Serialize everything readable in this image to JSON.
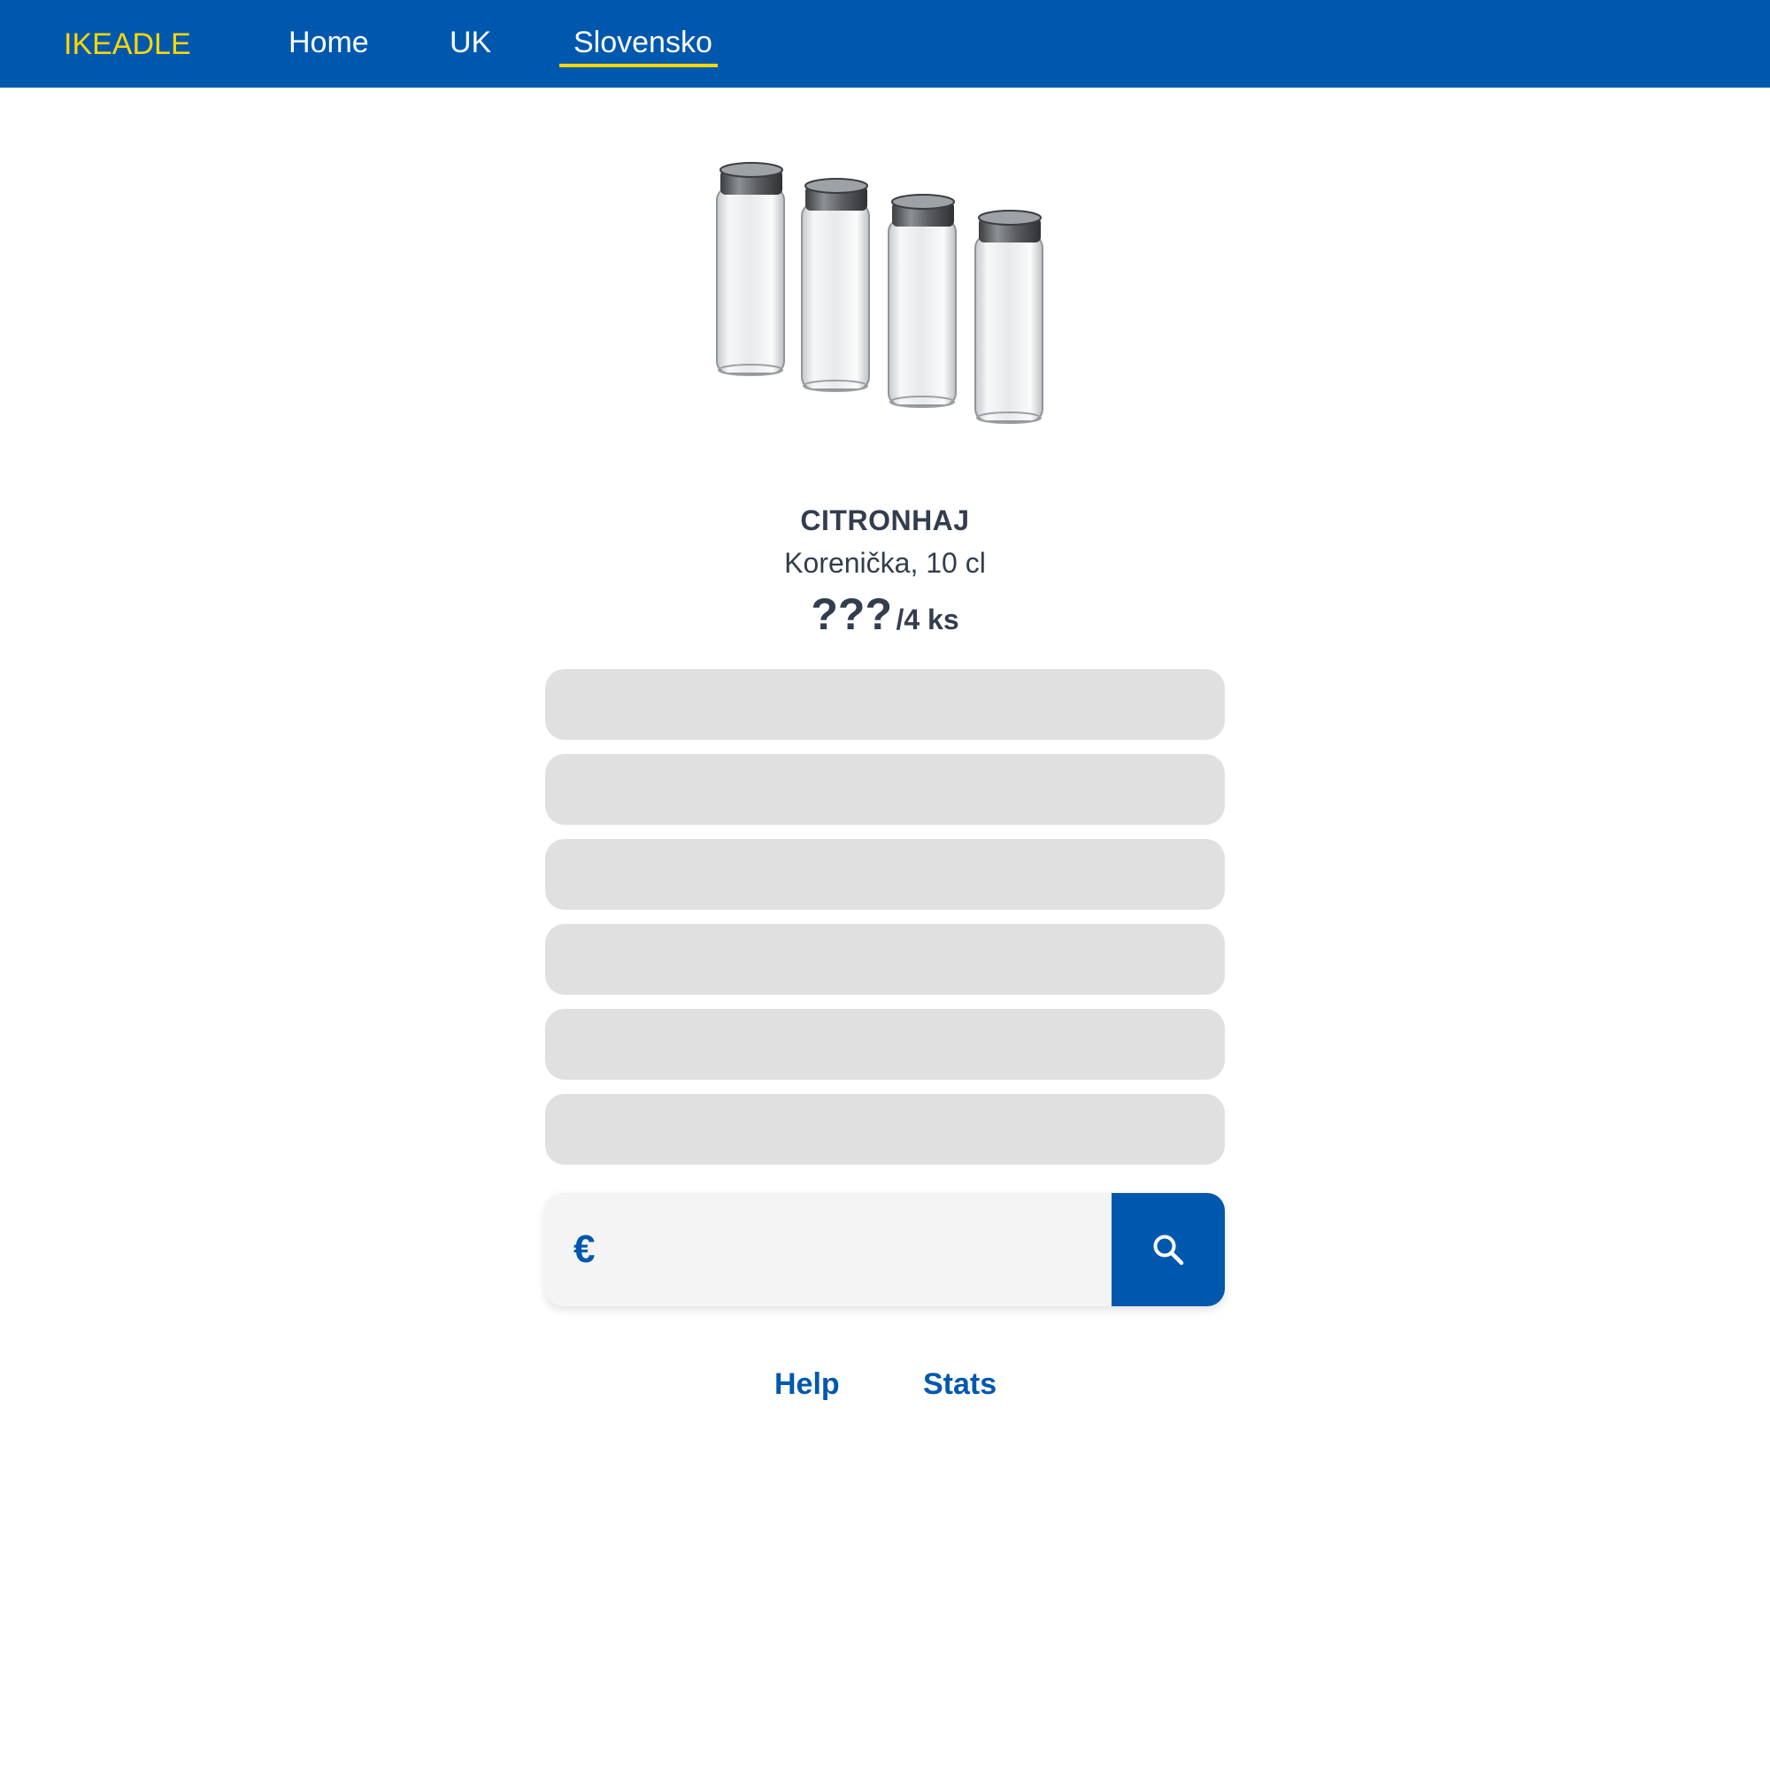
{
  "header": {
    "brand": "IKEADLE",
    "nav": [
      {
        "label": "Home"
      },
      {
        "label": "UK"
      },
      {
        "label": "Slovensko",
        "active": true
      }
    ]
  },
  "product": {
    "image_icon": "spice-jars-image",
    "name": "CITRONHAJ",
    "description": "Korenička, 10 cl",
    "price_hidden": "???",
    "price_unit": "/4 ks"
  },
  "guesses": {
    "slots_total": 6,
    "slots_filled": 0
  },
  "guess_form": {
    "currency_symbol": "€",
    "input_value": "",
    "input_placeholder": "",
    "submit_icon": "search-icon"
  },
  "footer": {
    "help": "Help",
    "stats": "Stats"
  },
  "colors": {
    "brand_blue": "#0058ae",
    "brand_yellow": "#ffd700",
    "text_dark": "#333d4d",
    "slot_empty": "#e0e0e0",
    "input_bg": "#f4f4f4"
  }
}
